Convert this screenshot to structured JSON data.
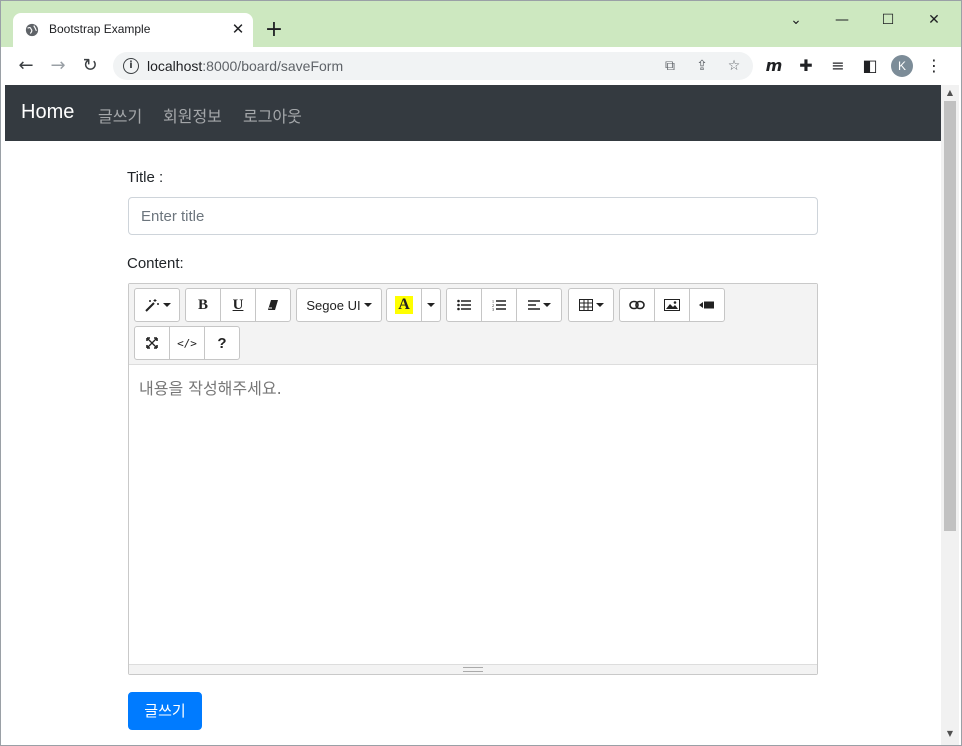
{
  "browser": {
    "tab_title": "Bootstrap Example",
    "tab_close": "✕",
    "new_tab": "+",
    "window_controls": {
      "dropdown": "⌄",
      "minimize": "—",
      "maximize": "☐",
      "close": "✕"
    },
    "url_host": "localhost",
    "url_path": ":8000/board/saveForm",
    "profile_initial": "K"
  },
  "navbar": {
    "brand": "Home",
    "links": [
      "글쓰기",
      "회원정보",
      "로그아웃"
    ]
  },
  "form": {
    "title_label": "Title :",
    "title_placeholder": "Enter title",
    "content_label": "Content:",
    "editor_placeholder": "내용을 작성해주세요.",
    "submit_label": "글쓰기"
  },
  "editor_toolbar": {
    "bold": "B",
    "underline": "U",
    "font_name": "Segoe UI",
    "color_letter": "A",
    "help": "?",
    "codeview": "</>"
  },
  "colors": {
    "tab_strip": "#cde8c0",
    "navbar_bg": "#343a40",
    "primary_button": "#007bff",
    "highlight_yellow": "#ffff00"
  }
}
